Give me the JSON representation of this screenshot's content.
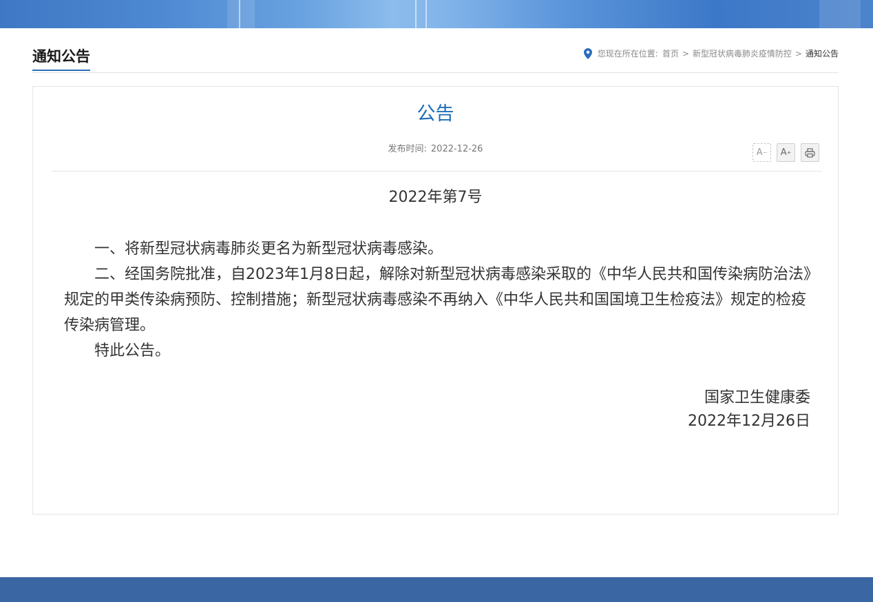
{
  "section": {
    "title": "通知公告"
  },
  "breadcrumb": {
    "prefix": "您现在所在位置:",
    "items": [
      "首页",
      "新型冠状病毒肺炎疫情防控"
    ],
    "separator": ">",
    "current": "通知公告"
  },
  "article": {
    "title": "公告",
    "publish_label": "发布时间:",
    "publish_date": "2022-12-26",
    "doc_number": "2022年第7号",
    "paragraphs": [
      "一、将新型冠状病毒肺炎更名为新型冠状病毒感染。",
      "二、经国务院批准，自2023年1月8日起，解除对新型冠状病毒感染采取的《中华人民共和国传染病防治法》规定的甲类传染病预防、控制措施；新型冠状病毒感染不再纳入《中华人民共和国国境卫生检疫法》规定的检疫传染病管理。",
      "特此公告。"
    ],
    "signature_org": "国家卫生健康委",
    "signature_date": "2022年12月26日"
  },
  "tools": {
    "font_decrease_label": "A",
    "font_decrease_sup": "−",
    "font_increase_label": "A",
    "font_increase_sup": "+"
  },
  "colors": {
    "accent": "#1e6cb8",
    "underline": "#2a6ebb",
    "location_pin": "#2a6ebb",
    "footer": "#3a66a4"
  },
  "icons": {
    "location": "location-pin-icon",
    "print": "printer-icon"
  }
}
